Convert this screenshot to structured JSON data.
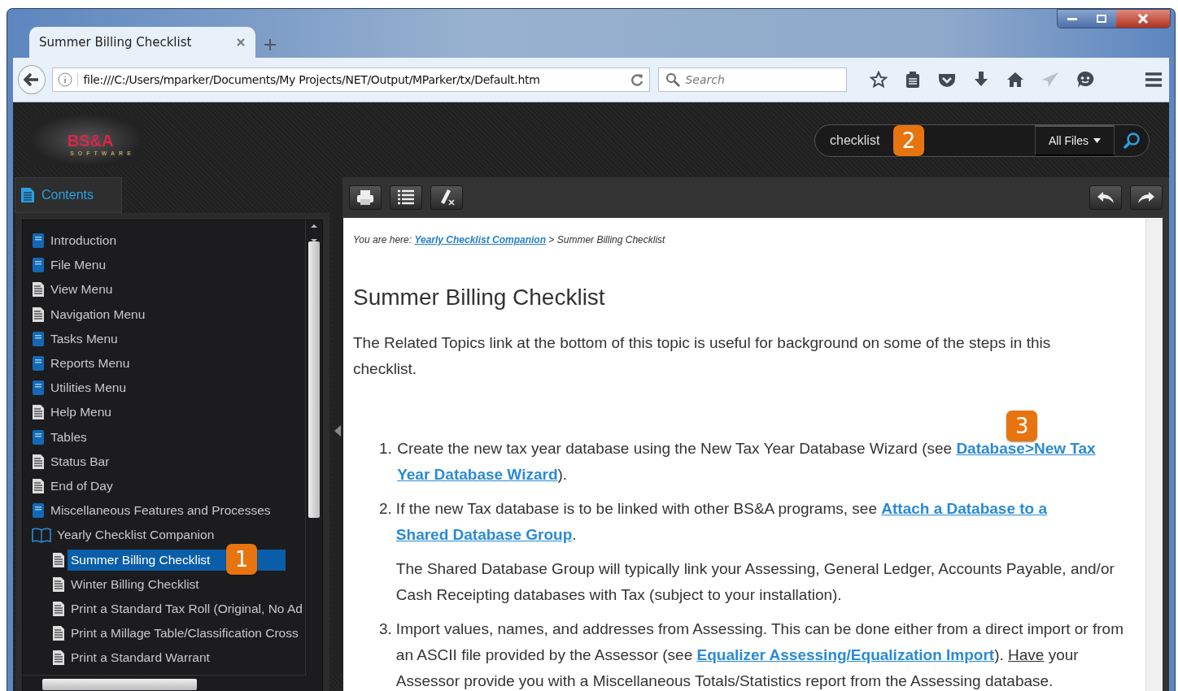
{
  "browser": {
    "tab_title": "Summer Billing Checklist",
    "url": "file:///C:/Users/mparker/Documents/My Projects/NET/Output/MParker/tx/Default.htm",
    "search_placeholder": "Search"
  },
  "header": {
    "logo_text": "BS&A",
    "logo_subtext": "SOFTWARE",
    "search_value": "checklist",
    "search_callout": "2",
    "scope": "All Files"
  },
  "sidebar": {
    "tab": "Contents",
    "items": [
      {
        "label": "Introduction",
        "kind": "book",
        "selected": false
      },
      {
        "label": "File Menu",
        "kind": "book",
        "selected": false
      },
      {
        "label": "View Menu",
        "kind": "page",
        "selected": false
      },
      {
        "label": "Navigation Menu",
        "kind": "page",
        "selected": false
      },
      {
        "label": "Tasks Menu",
        "kind": "book",
        "selected": false
      },
      {
        "label": "Reports Menu",
        "kind": "book",
        "selected": false
      },
      {
        "label": "Utilities Menu",
        "kind": "book",
        "selected": false
      },
      {
        "label": "Help Menu",
        "kind": "page",
        "selected": false
      },
      {
        "label": "Tables",
        "kind": "book",
        "selected": false
      },
      {
        "label": "Status Bar",
        "kind": "page",
        "selected": false
      },
      {
        "label": "End of Day",
        "kind": "page",
        "selected": false
      },
      {
        "label": "Miscellaneous Features and Processes",
        "kind": "book",
        "selected": false
      },
      {
        "label": "Yearly Checklist Companion",
        "kind": "open-book",
        "selected": false,
        "expanded": true,
        "children": [
          {
            "label": "Summer Billing Checklist",
            "kind": "page",
            "selected": true,
            "callout": "1"
          },
          {
            "label": "Winter Billing Checklist",
            "kind": "page",
            "selected": false
          },
          {
            "label": "Print a Standard Tax Roll (Original, No Ad",
            "kind": "page",
            "selected": false
          },
          {
            "label": "Print a Millage Table/Classification Cross",
            "kind": "page",
            "selected": false
          },
          {
            "label": "Print a Standard Warrant",
            "kind": "page",
            "selected": false
          }
        ]
      }
    ]
  },
  "breadcrumb": {
    "prefix": "You are here:",
    "link": "Yearly Checklist Companion",
    "separator": ">",
    "current": "Summer Billing Checklist"
  },
  "article": {
    "title": "Summer Billing Checklist",
    "intro": "The Related Topics link at the bottom of this topic is useful for background on some of the steps in this checklist.",
    "steps": [
      {
        "number": "1.",
        "paragraphs": [
          [
            {
              "kind": "text",
              "text": "Create the new tax year database using the New Tax Year Database Wizard (see "
            },
            {
              "kind": "link",
              "text": "Database>New Tax",
              "callout": "3"
            },
            {
              "kind": "link",
              "text": "Year Database Wizard"
            },
            {
              "kind": "text",
              "text": ")."
            }
          ]
        ]
      },
      {
        "number": "2.",
        "paragraphs": [
          [
            {
              "kind": "text",
              "text": "If the new Tax database is to be linked with other BS&A programs, see "
            },
            {
              "kind": "link",
              "text": "Attach a Database to a"
            },
            {
              "kind": "link",
              "text": "Shared Database Group"
            },
            {
              "kind": "text",
              "text": "."
            }
          ],
          [
            {
              "kind": "text",
              "text": "The Shared Database Group will typically link your Assessing, General Ledger, Accounts Payable, and/or Cash Receipting databases with Tax (subject to your installation)."
            }
          ]
        ]
      },
      {
        "number": "3.",
        "paragraphs": [
          [
            {
              "kind": "text",
              "text": "Import values, names, and addresses from Assessing. This can be done either from a direct import or from an ASCII file provided by the Assessor (see "
            },
            {
              "kind": "link",
              "text": "Equalizer Assessing/Equalization Import"
            },
            {
              "kind": "text",
              "text": "). "
            },
            {
              "kind": "underline",
              "text": "Have"
            },
            {
              "kind": "text",
              "text": " your Assessor provide you with a Miscellaneous Totals/Statistics report from the Assessing database."
            }
          ]
        ]
      }
    ]
  }
}
